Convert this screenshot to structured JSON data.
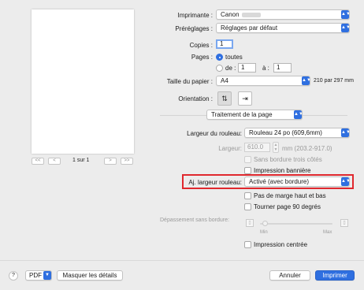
{
  "header": {
    "printer_label": "Imprimante :",
    "printer_value": "Canon",
    "presets_label": "Préréglages :",
    "presets_value": "Réglages par défaut",
    "copies_label": "Copies :",
    "copies_value": "1",
    "pages_label": "Pages :",
    "pages_all": "toutes",
    "pages_from": "de :",
    "pages_from_value": "1",
    "pages_to": "à :",
    "pages_to_value": "1",
    "paper_size_label": "Taille du papier :",
    "paper_size_value": "A4",
    "paper_size_dims": "210 par 297 mm",
    "orientation_label": "Orientation :"
  },
  "preview": {
    "page_counter": "1 sur 1",
    "first_label": "<<",
    "prev_label": "<",
    "next_label": ">",
    "last_label": ">>"
  },
  "section": {
    "dropdown_value": "Traitement de la page"
  },
  "roll": {
    "width_label": "Largeur du rouleau:",
    "width_value": "Rouleau 24 po (609,6mm)",
    "custom_width_label": "Largeur:",
    "custom_width_value": "610.0",
    "custom_width_unit": "mm (203.2-917.0)",
    "no_border_three_sides": "Sans bordure trois côtés",
    "banner_print": "Impression bannière",
    "adjust_label": "Aj. largeur rouleau:",
    "adjust_value": "Activé (avec bordure)",
    "no_top_bottom_margin": "Pas de marge haut et bas",
    "rotate_90": "Tourner page 90 degrés",
    "overflow_label": "Dépassement sans bordure:",
    "slider_min": "Min",
    "slider_max": "Max",
    "centered_print": "Impression centrée"
  },
  "footer": {
    "help": "?",
    "pdf": "PDF",
    "hide_details": "Masquer les détails",
    "cancel": "Annuler",
    "print": "Imprimer"
  },
  "colors": {
    "accent": "#2f6fe0",
    "highlight": "#e0282e"
  }
}
